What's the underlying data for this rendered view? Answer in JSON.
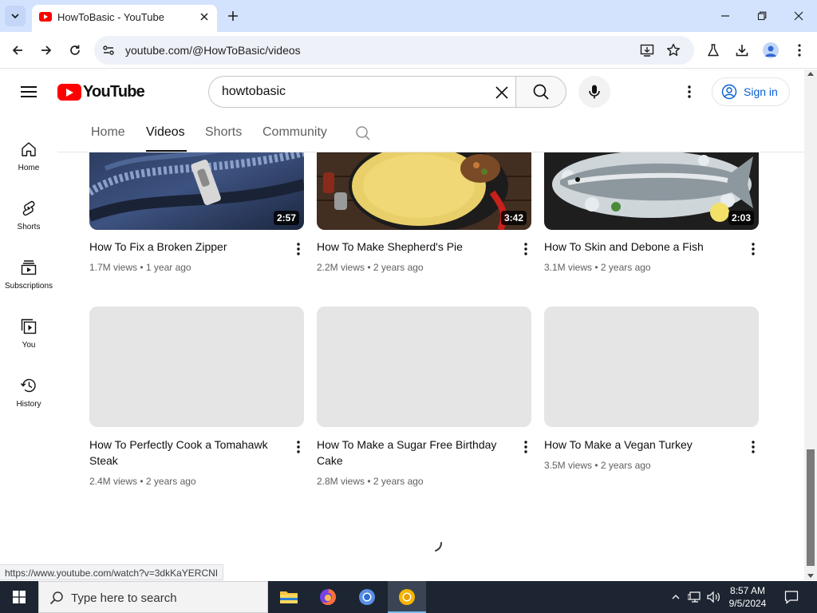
{
  "browser": {
    "tab_title": "HowToBasic - YouTube",
    "url": "youtube.com/@HowToBasic/videos",
    "status_url": "https://www.youtube.com/watch?v=3dkKaYERCNI"
  },
  "youtube": {
    "logo_text": "YouTube",
    "search_value": "howtobasic",
    "sign_in_label": "Sign in",
    "channel_tabs": [
      "Home",
      "Videos",
      "Shorts",
      "Community"
    ],
    "active_tab": "Videos"
  },
  "guide": [
    {
      "label": "Home",
      "icon": "home-icon"
    },
    {
      "label": "Shorts",
      "icon": "shorts-icon"
    },
    {
      "label": "Subscriptions",
      "icon": "subscriptions-icon"
    },
    {
      "label": "You",
      "icon": "you-icon"
    },
    {
      "label": "History",
      "icon": "history-icon"
    }
  ],
  "videos": [
    {
      "title": "How To Fix a Broken Zipper",
      "meta": "1.7M views • 1 year ago",
      "duration": "2:57",
      "thumb": "zipper"
    },
    {
      "title": "How To Make Shepherd's Pie",
      "meta": "2.2M views • 2 years ago",
      "duration": "3:42",
      "thumb": "pie"
    },
    {
      "title": "How To Skin and Debone a Fish",
      "meta": "3.1M views • 2 years ago",
      "duration": "2:03",
      "thumb": "fish"
    },
    {
      "title": "How To Perfectly Cook a Tomahawk Steak",
      "meta": "2.4M views • 2 years ago",
      "duration": "",
      "thumb": "placeholder"
    },
    {
      "title": "How To Make a Sugar Free Birthday Cake",
      "meta": "2.8M views • 2 years ago",
      "duration": "",
      "thumb": "placeholder"
    },
    {
      "title": "How To Make a Vegan Turkey",
      "meta": "3.5M views • 2 years ago",
      "duration": "",
      "thumb": "placeholder"
    }
  ],
  "taskbar": {
    "search_placeholder": "Type here to search",
    "time": "8:57 AM",
    "date": "9/5/2024"
  },
  "colors": {
    "accent_blue": "#065fd4",
    "youtube_red": "#ff0000",
    "tabstrip": "#d3e3fd"
  }
}
